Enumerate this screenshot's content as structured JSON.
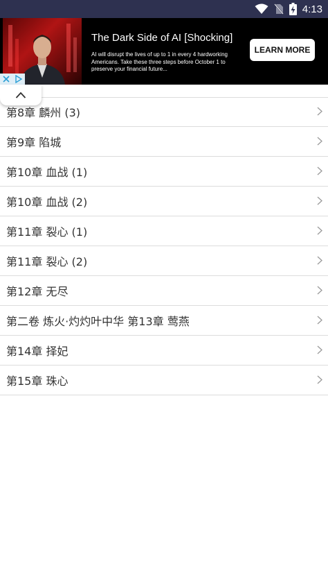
{
  "status_bar": {
    "time": "4:13"
  },
  "ad": {
    "headline": "The Dark Side of AI [Shocking]",
    "body": "AI will disrupt the lives of up to 1 in every 4 hardworking Americans. Take these three steps before October 1 to preserve your financial future...",
    "cta": "LEARN MORE"
  },
  "chapters": [
    {
      "title": "第8章 麟州 (3)"
    },
    {
      "title": "第9章 陷城"
    },
    {
      "title": "第10章 血战 (1)"
    },
    {
      "title": "第10章 血战 (2)"
    },
    {
      "title": "第11章 裂心 (1)"
    },
    {
      "title": "第11章 裂心 (2)"
    },
    {
      "title": "第12章 无尽"
    },
    {
      "title": "第二卷 炼火·灼灼叶中华 第13章 莺燕"
    },
    {
      "title": "第14章 择妃"
    },
    {
      "title": "第15章 珠心"
    }
  ]
}
